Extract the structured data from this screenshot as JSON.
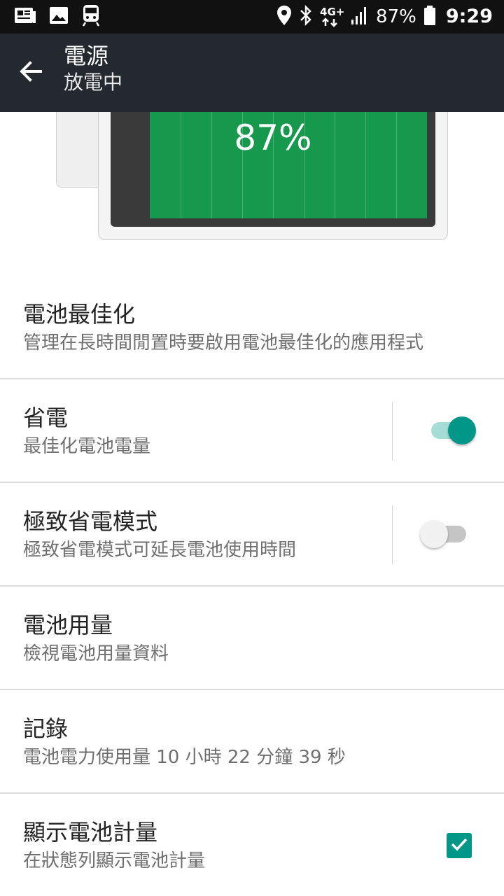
{
  "status_bar": {
    "left_icons": [
      "news-icon",
      "image-icon",
      "train-icon"
    ],
    "right_icons": [
      "location-icon",
      "bluetooth-icon",
      "network-4g-icon",
      "signal-icon",
      "battery-icon"
    ],
    "network_label": "4G+",
    "battery_percent": "87%",
    "time": "9:29"
  },
  "app_bar": {
    "back_icon": "arrow-left-icon",
    "title": "電源",
    "subtitle": "放電中"
  },
  "battery_graphic": {
    "percent_text": "87%",
    "level": 0.87,
    "fill_color": "#16994d"
  },
  "settings": [
    {
      "title": "電池最佳化",
      "summary": "管理在長時間閒置時要啟用電池最佳化的應用程式"
    },
    {
      "title": "省電",
      "summary": "最佳化電池電量",
      "control": "switch",
      "checked": true
    },
    {
      "title": "極致省電模式",
      "summary": "極致省電模式可延長電池使用時間",
      "control": "switch",
      "checked": false
    },
    {
      "title": "電池用量",
      "summary": "檢視電池用量資料"
    },
    {
      "title": "記錄",
      "summary": "電池電力使用量 10 小時 22 分鐘 39 秒"
    },
    {
      "title": "顯示電池計量",
      "summary": "在狀態列顯示電池計量",
      "control": "checkbox",
      "checked": true
    }
  ],
  "colors": {
    "accent": "#009688",
    "app_bar": "#23292e",
    "status_bar": "#111111"
  }
}
